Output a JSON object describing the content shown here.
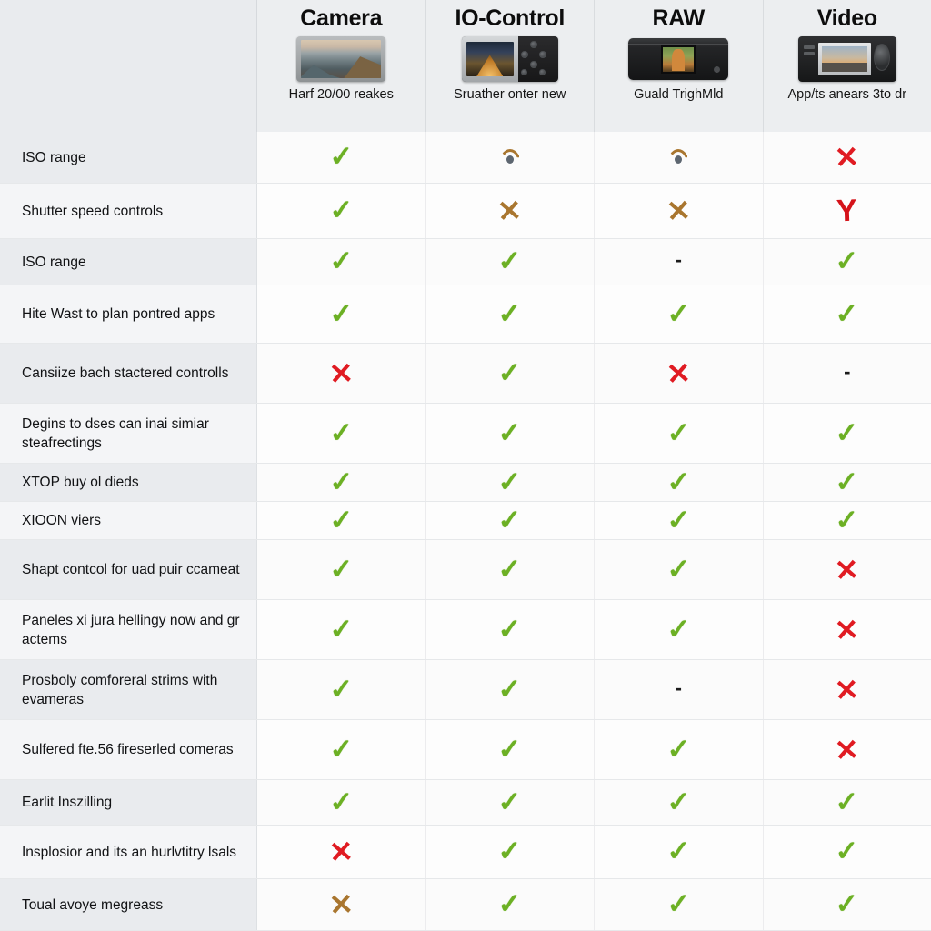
{
  "table": {
    "feature_column_header": "",
    "products": [
      {
        "name": "Camera",
        "thumbnail": "camera-lcd-landscape-thumbnail",
        "subtitle": "Harf 20/00 reakes"
      },
      {
        "name": "IO-Control",
        "thumbnail": "camera-back-control-pad-thumbnail",
        "subtitle": "Sruather onter new"
      },
      {
        "name": "RAW",
        "thumbnail": "dark-camera-back-lcd-thumbnail",
        "subtitle": "Guald TrighMld"
      },
      {
        "name": "Video",
        "thumbnail": "camcorder-lcd-dial-thumbnail",
        "subtitle": "App/ts anears 3to dr"
      }
    ],
    "rows": [
      {
        "feature": "ISO range",
        "values": [
          "check",
          "eye",
          "eye",
          "cross-red"
        ]
      },
      {
        "feature": "Shutter speed controls",
        "values": [
          "check",
          "cross-brown",
          "cross-brown",
          "y-red"
        ]
      },
      {
        "feature": "ISO range",
        "values": [
          "check",
          "check",
          "dash",
          "check"
        ]
      },
      {
        "feature": "Hite Wast to plan pontred apps",
        "values": [
          "check",
          "check",
          "check",
          "check"
        ]
      },
      {
        "feature": "Cansiize bach stactered controlls",
        "values": [
          "cross-red",
          "check",
          "cross-red",
          "dash"
        ]
      },
      {
        "feature": "Degins to dses can inai simiar steafrectings",
        "values": [
          "check",
          "check",
          "check",
          "check"
        ]
      },
      {
        "feature": "XTOP buy ol dieds",
        "values": [
          "check",
          "check",
          "check",
          "check"
        ]
      },
      {
        "feature": "XIOON viers",
        "values": [
          "check",
          "check",
          "check",
          "check"
        ]
      },
      {
        "feature": "Shapt contcol for uad puir ccameat",
        "values": [
          "check",
          "check",
          "check",
          "cross-red"
        ]
      },
      {
        "feature": "Paneles xi jura hellingy now and gr actems",
        "values": [
          "check",
          "check",
          "check",
          "cross-red"
        ]
      },
      {
        "feature": "Prosboly comforeral strims with evameras",
        "values": [
          "check",
          "check",
          "dash",
          "cross-red"
        ]
      },
      {
        "feature": "Sulfered fte.56 fireserled comeras",
        "values": [
          "check",
          "check",
          "check",
          "cross-red"
        ]
      },
      {
        "feature": "Earlit Inszilling",
        "values": [
          "check",
          "check",
          "check",
          "check"
        ]
      },
      {
        "feature": "Insplosior and its an hurlvtitry lsals",
        "values": [
          "cross-red",
          "check",
          "check",
          "check"
        ]
      },
      {
        "feature": "Toual avoye megreass",
        "values": [
          "cross-brown",
          "check",
          "check",
          "check"
        ]
      }
    ]
  },
  "colors": {
    "check_green": "#6cb024",
    "cross_red": "#e01b22",
    "cross_brown": "#a9762f",
    "header_bg": "#e9ebee",
    "stripe_bg": "#e9ebee",
    "cell_bg": "#fcfcfc"
  },
  "glyphs": {
    "check": "✓",
    "cross": "✕",
    "y": "Υ",
    "dash": "-"
  }
}
